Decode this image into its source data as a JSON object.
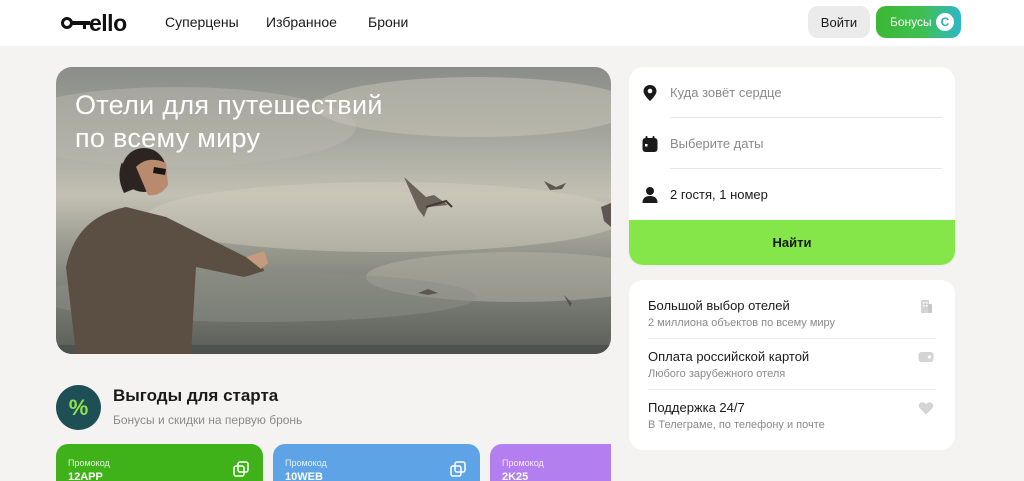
{
  "header": {
    "logo_text": "ello",
    "nav": [
      "Суперцены",
      "Избранное",
      "Брони"
    ],
    "login_label": "Войти",
    "bonus_label": "Бонусы",
    "bonus_coin": "С"
  },
  "hero": {
    "title_line1": "Отели для путешествий",
    "title_line2": "по всему миру"
  },
  "search": {
    "destination_placeholder": "Куда зовёт сердце",
    "dates_placeholder": "Выберите даты",
    "guests_value": "2 гостя, 1 номер",
    "find_label": "Найти"
  },
  "features": [
    {
      "title": "Большой выбор отелей",
      "subtitle": "2 миллиона объектов по всему миру",
      "icon": "building-icon"
    },
    {
      "title": "Оплата российской картой",
      "subtitle": "Любого зарубежного отеля",
      "icon": "card-icon"
    },
    {
      "title": "Поддержка 24/7",
      "subtitle": "В Телеграме, по телефону и почте",
      "icon": "heart-icon"
    }
  ],
  "benefits": {
    "badge": "%",
    "title": "Выгоды для старта",
    "subtitle": "Бонусы и скидки на первую бронь"
  },
  "promos": [
    {
      "label": "Промокод",
      "code": "12APP",
      "color": "#3fb21a"
    },
    {
      "label": "Промокод",
      "code": "10WEB",
      "color": "#5da3e6"
    },
    {
      "label": "Промокод",
      "code": "2K25",
      "color": "#b27ef0"
    }
  ],
  "colors": {
    "accent_green": "#84e649",
    "dark_teal": "#1e4f54",
    "page_bg": "#f4f3f1"
  }
}
